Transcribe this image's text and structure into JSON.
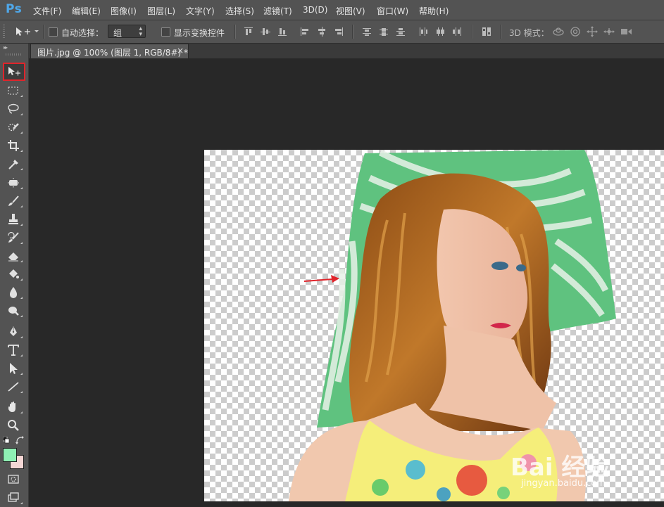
{
  "app": {
    "logo": "Ps",
    "accent": "#4fa8ea"
  },
  "menu": [
    {
      "label": "文件(F)"
    },
    {
      "label": "编辑(E)"
    },
    {
      "label": "图像(I)"
    },
    {
      "label": "图层(L)"
    },
    {
      "label": "文字(Y)"
    },
    {
      "label": "选择(S)"
    },
    {
      "label": "滤镜(T)"
    },
    {
      "label": "3D(D)"
    },
    {
      "label": "视图(V)"
    },
    {
      "label": "窗口(W)"
    },
    {
      "label": "帮助(H)"
    }
  ],
  "options": {
    "auto_select_label": "自动选择：",
    "auto_select_checked": false,
    "auto_select_target": "组",
    "show_transform_label": "显示变换控件",
    "show_transform_checked": false,
    "mode_3d_label": "3D 模式："
  },
  "tools": [
    {
      "name": "move-tool",
      "icon": "move-icon",
      "active": true
    },
    {
      "name": "marquee-tool",
      "icon": "marquee-icon"
    },
    {
      "name": "lasso-tool",
      "icon": "lasso-icon"
    },
    {
      "name": "quick-select-tool",
      "icon": "quick-select-icon"
    },
    {
      "name": "crop-tool",
      "icon": "crop-icon"
    },
    {
      "name": "eyedropper-tool",
      "icon": "eyedropper-icon"
    },
    {
      "name": "healing-brush-tool",
      "icon": "healing-icon"
    },
    {
      "name": "brush-tool",
      "icon": "brush-icon"
    },
    {
      "name": "clone-stamp-tool",
      "icon": "stamp-icon"
    },
    {
      "name": "history-brush-tool",
      "icon": "history-brush-icon"
    },
    {
      "name": "eraser-tool",
      "icon": "eraser-icon"
    },
    {
      "name": "paint-bucket-tool",
      "icon": "bucket-icon"
    },
    {
      "name": "blur-tool",
      "icon": "blur-icon"
    },
    {
      "name": "dodge-tool",
      "icon": "dodge-icon"
    },
    {
      "name": "pen-tool",
      "icon": "pen-icon"
    },
    {
      "name": "type-tool",
      "icon": "type-icon",
      "glyph": "T"
    },
    {
      "name": "path-selection-tool",
      "icon": "path-select-icon"
    },
    {
      "name": "line-tool",
      "icon": "line-icon"
    },
    {
      "name": "hand-tool",
      "icon": "hand-icon"
    },
    {
      "name": "zoom-tool",
      "icon": "zoom-icon"
    }
  ],
  "colors": {
    "foreground": "#8ff0b4",
    "background": "#f5d7d5",
    "highlight": "#e0242b"
  },
  "document": {
    "tab_title": "图片.jpg @ 100% (图层 1, RGB/8#) *",
    "close_glyph": "×"
  },
  "watermark": {
    "line1": "Bai 经验",
    "line2": "jingyan.baidu.com"
  }
}
